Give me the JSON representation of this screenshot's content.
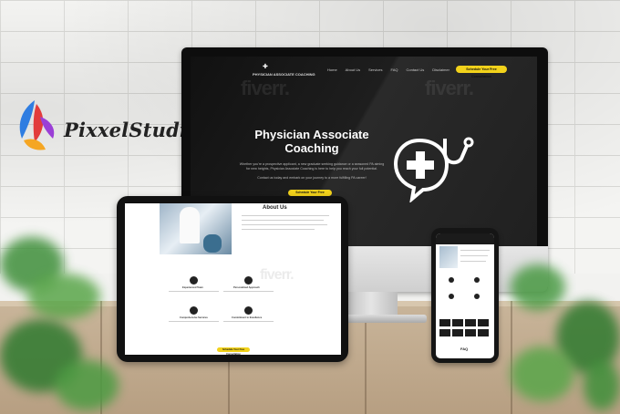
{
  "brand": {
    "name": "PixxelStudio"
  },
  "website": {
    "nav_brand": "PHYSICIAN ASSOCIATE COACHING",
    "nav_links": [
      "Home",
      "About Us",
      "Services",
      "FAQ",
      "Contact Us",
      "Disclaimer"
    ],
    "nav_cta": "Schedule Your Free Consultation",
    "watermark": "fiverr.",
    "hero_title": "Physician Associate Coaching",
    "hero_text": "Whether you're a prospective applicant, a new graduate seeking guidance or a seasoned PA aiming for new heights, Physician Associate Coaching is here to help you reach your full potential.",
    "hero_text2": "Contact us today and embark on your journey to a more fulfilling PA career!",
    "hero_button": "Schedule Your Free Consultation"
  },
  "tablet": {
    "about_title": "About Us",
    "features": [
      "Experienced Team",
      "Personalized Approach",
      "Comprehensive Services",
      "Commitment to Excellence"
    ],
    "button": "Schedule Your Free Consultation"
  },
  "phone": {
    "faq": "FAQ"
  },
  "colors": {
    "accent": "#f2d21b",
    "screen_bg": "#1c1c1c"
  }
}
